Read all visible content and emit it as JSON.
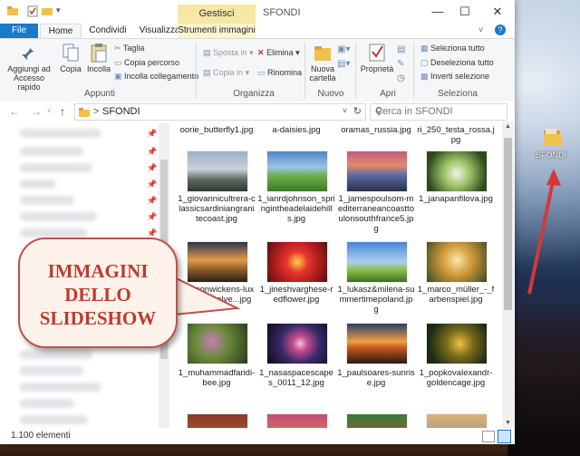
{
  "window": {
    "quick_access_title": "SFONDI",
    "context_tab_group": "Gestisci",
    "controls": {
      "minimize": "—",
      "maximize": "☐",
      "close": "✕"
    }
  },
  "tabs": [
    "File",
    "Home",
    "Condividi",
    "Visualizza",
    "Strumenti immagini"
  ],
  "ribbon": {
    "appunti": {
      "label": "Appunti",
      "pin": "Aggiungi ad Accesso rapido",
      "copy": "Copia",
      "paste": "Incolla",
      "cut": "Taglia",
      "copy_path": "Copia percorso",
      "paste_shortcut": "Incolla collegamento"
    },
    "organizza": {
      "label": "Organizza",
      "move_to": "Sposta in",
      "copy_to": "Copia in",
      "delete": "Elimina",
      "rename": "Rinomina"
    },
    "nuovo": {
      "label": "Nuovo",
      "new_folder": "Nuova cartella"
    },
    "apri": {
      "label": "Apri",
      "properties": "Proprietà"
    },
    "seleziona": {
      "label": "Seleziona",
      "select_all": "Seleziona tutto",
      "deselect_all": "Deseleziona tutto",
      "invert": "Inverti selezione"
    }
  },
  "address": {
    "path": "SFONDI",
    "search_placeholder": "Cerca in SFONDI",
    "separator": ">"
  },
  "files": {
    "row1": [
      "oorie_butterfly1.jpg",
      "a-daisies.jpg",
      "oramas_russia.jpg",
      "ri_250_testa_rossa.jpg"
    ],
    "row2": [
      "1_giovannicultrera-classicsardiniangranitecoast.jpg",
      "1_ianrdjohnson_springintheadelaidehills.jpg",
      "1_jamespoulsom-mediterraneancoasttoulonsouthfrance5.jpg",
      "1_janapanfilova.jpg"
    ],
    "row3": [
      "1_jasonwickens-luxurylightmalve...jpg",
      "1_jineshvarghese-redflower.jpg",
      "1_lukasz&milena-summertimepoland.jpg",
      "1_marco_müller_-_farbenspiel.jpg"
    ],
    "row4": [
      "1_muhammadfaridi-bee.jpg",
      "1_nasaspacescapes_0011_12.jpg",
      "1_paulsoares-sunrise.jpg",
      "1_popkovalexandr-goldencage.jpg"
    ]
  },
  "status": {
    "count": "1.100 elementi"
  },
  "callout": {
    "line1": "IMMAGINI",
    "line2": "DELLO",
    "line3": "SLIDESHOW"
  },
  "desktop_icon": {
    "label": "SFONDI"
  },
  "colors": {
    "accent": "#1979ca",
    "callout_border": "#c0504d",
    "callout_text": "#c0392b",
    "arrow": "#d23a3a"
  }
}
